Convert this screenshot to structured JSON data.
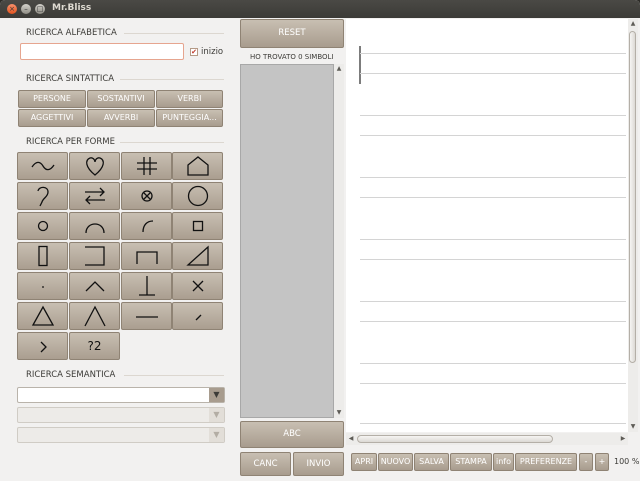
{
  "window": {
    "title": "Mr.Bliss",
    "close_glyph": "×",
    "min_glyph": "–",
    "max_glyph": "□"
  },
  "alphabetic": {
    "label": "RICERCA ALFABETICA",
    "input_value": "",
    "checkbox_label": "inizio",
    "checkbox_checked": true,
    "check_glyph": "✔"
  },
  "syntactic": {
    "label": "RICERCA SINTATTICA",
    "buttons": [
      "PERSONE",
      "SOSTANTIVI",
      "VERBI",
      "AGGETTIVI",
      "AVVERBI",
      "PUNTEGGIA..."
    ]
  },
  "shapes": {
    "label": "RICERCA PER FORME",
    "icons": [
      "wave-icon",
      "heart-icon",
      "hash-icon",
      "house-icon",
      "ear-hook-icon",
      "exchange-arrows-icon",
      "circled-x-icon",
      "large-circle-icon",
      "small-circle-icon",
      "arch-icon",
      "quarter-arc-icon",
      "small-square-icon",
      "tall-rectangle-icon",
      "open-left-bracket-icon",
      "open-bottom-bracket-icon",
      "right-triangle-icon",
      "dot-icon",
      "caret-up-icon",
      "perpendicular-icon",
      "multiply-icon",
      "triangle-icon",
      "lambda-icon",
      "horizontal-line-icon",
      "short-diagonal-icon",
      "greater-than-icon",
      "unknown-size-icon"
    ],
    "unknown_label": "?2"
  },
  "semantic": {
    "label": "RICERCA SEMANTICA",
    "combo1_value": "",
    "combo2_value": "",
    "combo3_value": "",
    "arrow_glyph": "▼"
  },
  "middle": {
    "reset_label": "RESET",
    "status": "HO TROVATO 0 SIMBOLI",
    "abc_label": "ABC",
    "canc_label": "CANC",
    "invio_label": "INVIO",
    "up_glyph": "▲",
    "down_glyph": "▼"
  },
  "editor": {
    "left_glyph": "◀",
    "right_glyph": "▶",
    "up_glyph": "▲",
    "down_glyph": "▼"
  },
  "toolbar": {
    "apri": "APRI",
    "nuovo": "NUOVO",
    "salva": "SALVA",
    "stampa": "STAMPA",
    "info": "info",
    "preferenze": "PREFERENZE",
    "minus": "-",
    "plus": "+",
    "zoom": "100 %"
  },
  "colors": {
    "button": "#a89c8e",
    "accent_border": "#e6a58f",
    "list_bg": "#c4c4c4"
  }
}
